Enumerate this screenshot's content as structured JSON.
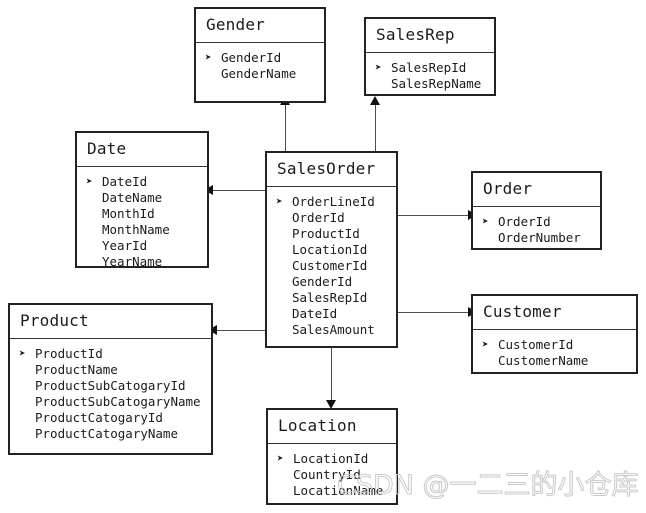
{
  "diagram": {
    "type": "star-schema-erd",
    "key_marker": "➤",
    "entities": [
      {
        "id": "gender",
        "title": "Gender",
        "fields": [
          {
            "name": "GenderId",
            "key": true
          },
          {
            "name": "GenderName",
            "key": false
          }
        ]
      },
      {
        "id": "salesrep",
        "title": "SalesRep",
        "fields": [
          {
            "name": "SalesRepId",
            "key": true
          },
          {
            "name": "SalesRepName",
            "key": false
          }
        ]
      },
      {
        "id": "date",
        "title": "Date",
        "fields": [
          {
            "name": "DateId",
            "key": true
          },
          {
            "name": "DateName",
            "key": false
          },
          {
            "name": "MonthId",
            "key": false
          },
          {
            "name": "MonthName",
            "key": false
          },
          {
            "name": "YearId",
            "key": false
          },
          {
            "name": "YearName",
            "key": false
          }
        ]
      },
      {
        "id": "salesorder",
        "title": "SalesOrder",
        "fields": [
          {
            "name": "OrderLineId",
            "key": true
          },
          {
            "name": "OrderId",
            "key": false
          },
          {
            "name": "ProductId",
            "key": false
          },
          {
            "name": "LocationId",
            "key": false
          },
          {
            "name": "CustomerId",
            "key": false
          },
          {
            "name": "GenderId",
            "key": false
          },
          {
            "name": "SalesRepId",
            "key": false
          },
          {
            "name": "DateId",
            "key": false
          },
          {
            "name": "SalesAmount",
            "key": false
          }
        ]
      },
      {
        "id": "order",
        "title": "Order",
        "fields": [
          {
            "name": "OrderId",
            "key": true
          },
          {
            "name": "OrderNumber",
            "key": false
          }
        ]
      },
      {
        "id": "customer",
        "title": "Customer",
        "fields": [
          {
            "name": "CustomerId",
            "key": true
          },
          {
            "name": "CustomerName",
            "key": false
          }
        ]
      },
      {
        "id": "product",
        "title": "Product",
        "fields": [
          {
            "name": "ProductId",
            "key": true
          },
          {
            "name": "ProductName",
            "key": false
          },
          {
            "name": "ProductSubCatogaryId",
            "key": false
          },
          {
            "name": "ProductSubCatogaryName",
            "key": false
          },
          {
            "name": "ProductCatogaryId",
            "key": false
          },
          {
            "name": "ProductCatogaryName",
            "key": false
          }
        ]
      },
      {
        "id": "location",
        "title": "Location",
        "fields": [
          {
            "name": "LocationId",
            "key": true
          },
          {
            "name": "CountryId",
            "key": false
          },
          {
            "name": "LocationName",
            "key": false
          }
        ]
      }
    ],
    "relationships": [
      {
        "from": "salesorder",
        "to": "gender",
        "direction": "up"
      },
      {
        "from": "salesorder",
        "to": "salesrep",
        "direction": "up"
      },
      {
        "from": "salesorder",
        "to": "date",
        "direction": "left"
      },
      {
        "from": "salesorder",
        "to": "order",
        "direction": "right"
      },
      {
        "from": "salesorder",
        "to": "customer",
        "direction": "right"
      },
      {
        "from": "salesorder",
        "to": "product",
        "direction": "left"
      },
      {
        "from": "salesorder",
        "to": "location",
        "direction": "down"
      }
    ]
  },
  "watermark": {
    "text": "CSDN @一二三的小仓库"
  }
}
